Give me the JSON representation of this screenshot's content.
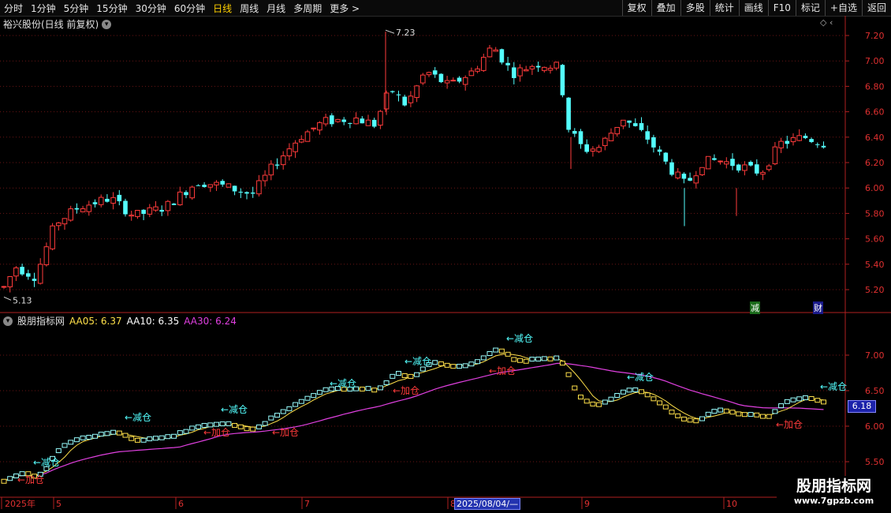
{
  "toolbar": {
    "left": [
      {
        "label": "分时",
        "active": false
      },
      {
        "label": "1分钟",
        "active": false
      },
      {
        "label": "5分钟",
        "active": false
      },
      {
        "label": "15分钟",
        "active": false
      },
      {
        "label": "30分钟",
        "active": false
      },
      {
        "label": "60分钟",
        "active": false
      },
      {
        "label": "日线",
        "active": true
      },
      {
        "label": "周线",
        "active": false
      },
      {
        "label": "月线",
        "active": false
      },
      {
        "label": "多周期",
        "active": false
      },
      {
        "label": "更多 >",
        "active": false
      }
    ],
    "right": [
      "复权",
      "叠加",
      "多股",
      "统计",
      "画线",
      "F10",
      "标记",
      "+自选",
      "返回"
    ]
  },
  "main_chart": {
    "title": "裕兴股份(日线 前复权)",
    "y_axis": [
      "7.20",
      "7.00",
      "6.80",
      "6.60",
      "6.40",
      "6.20",
      "6.00",
      "5.80",
      "5.60",
      "5.40",
      "5.20"
    ],
    "high_label": "7.23",
    "low_label": "5.13",
    "tag_reduce": "减",
    "tag_finance": "财"
  },
  "indicator": {
    "name": "股朋指标网",
    "aa05": "AA05: 6.37",
    "aa10": "AA10: 6.35",
    "aa30": "AA30: 6.24",
    "y_axis": [
      "7.00",
      "6.50",
      "6.00",
      "5.50"
    ],
    "current_price": "6.18",
    "signal_reduce": "←减仓",
    "signal_add": "←加仓"
  },
  "x_axis": {
    "labels": [
      "2025年",
      "5",
      "6",
      "7",
      "8",
      "9",
      "10"
    ],
    "cursor_date": "2025/08/04/—"
  },
  "watermark": {
    "main": "股朋指标网",
    "url": "www.7gpzb.com"
  },
  "colors": {
    "up": "#ff3b3b",
    "down": "#54ffff",
    "aa05": "#ffe04a",
    "aa10": "#ffffff",
    "aa30": "#e040e0"
  }
}
